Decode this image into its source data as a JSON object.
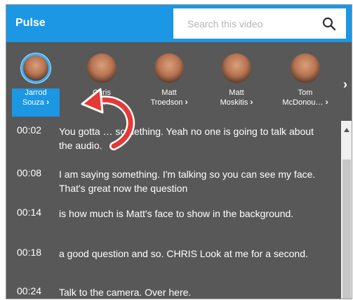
{
  "app": {
    "title": "Pulse"
  },
  "search": {
    "placeholder": "Search this video",
    "value": "",
    "icon": "search-icon"
  },
  "speakers": [
    {
      "name_line1": "Jarrod",
      "name_line2": "Souza",
      "active": true
    },
    {
      "name_line1": "Chris",
      "name_line2": "…n"
    },
    {
      "name_line1": "Matt",
      "name_line2": "Troedson"
    },
    {
      "name_line1": "Matt",
      "name_line2": "Moskitis"
    },
    {
      "name_line1": "Tom",
      "name_line2": "McDonou…"
    }
  ],
  "transcript": [
    {
      "time": "00:02",
      "text": "You gotta … something. Yeah no one is going to talk about the audio."
    },
    {
      "time": "00:08",
      "text": "I am saying something. I'm talking so you can see my face. That's great now the question"
    },
    {
      "time": "00:14",
      "text": "is how much is Matt's face to show in the background."
    },
    {
      "time": "00:18",
      "text": "a good question and so. CHRIS Look at me for a second."
    },
    {
      "time": "00:24",
      "text": "Talk to the camera. Over here."
    }
  ],
  "colors": {
    "accent": "#1b97e4",
    "panel": "#585858",
    "callout": "#e53935"
  }
}
